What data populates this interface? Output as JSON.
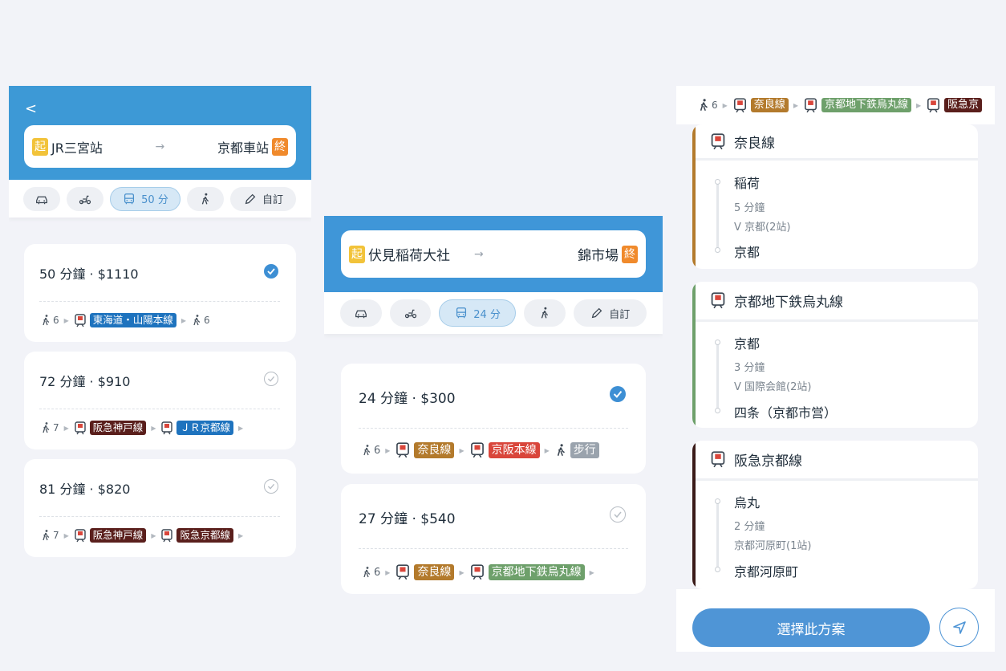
{
  "colors": {
    "header_blue": "#3d99d6",
    "selected_check": "#3d8fd4",
    "start_tag": "#f2c33a",
    "end_tag": "#f08a2c",
    "tokaido": "#1e73be",
    "hankyu": "#5a1f1c",
    "jr_kyoto": "#1e73be",
    "nara": "#b37a2c",
    "keihan": "#d9463b",
    "karasuma": "#6ea06b",
    "walk_tag": "#9aa3ad"
  },
  "screen1": {
    "back": "<",
    "start_tag": "起",
    "end_tag": "終",
    "origin": "JR三宮站",
    "arrow": "→",
    "destination": "京都車站",
    "modes": {
      "transit_label": "50 分",
      "custom_label": "自訂"
    },
    "routes": [
      {
        "summary": "50 分鐘 · $1110",
        "walk1": "6",
        "line1": "東海道・山陽本線",
        "walk2": "6"
      },
      {
        "summary": "72 分鐘 · $910",
        "walk1": "7",
        "line1": "阪急神戸線",
        "line2": "ＪＲ京都線"
      },
      {
        "summary": "81 分鐘 · $820",
        "walk1": "7",
        "line1": "阪急神戸線",
        "line2": "阪急京都線"
      }
    ]
  },
  "screen2": {
    "start_tag": "起",
    "end_tag": "終",
    "origin": "伏見稲荷大社",
    "arrow": "→",
    "destination": "錦市場",
    "modes": {
      "transit_label": "24 分",
      "custom_label": "自訂"
    },
    "routes": [
      {
        "summary": "24 分鐘 · $300",
        "walk1": "6",
        "line1": "奈良線",
        "line2": "京阪本線",
        "walk_tag": "步行"
      },
      {
        "summary": "27 分鐘 · $540",
        "walk1": "6",
        "line1": "奈良線",
        "line2": "京都地下鉄烏丸線"
      }
    ]
  },
  "screen3": {
    "topbar": {
      "walk": "6",
      "line1": "奈良線",
      "line2": "京都地下鉄烏丸線",
      "line3": "阪急京"
    },
    "segments": [
      {
        "line": "奈良線",
        "from": "稲荷",
        "duration": "5 分鐘",
        "via": "V 京都(2站)",
        "to": "京都"
      },
      {
        "line": "京都地下鉄烏丸線",
        "from": "京都",
        "duration": "3 分鐘",
        "via": "V 国際会館(2站)",
        "to": "四条（京都市営）"
      },
      {
        "line": "阪急京都線",
        "from": "烏丸",
        "duration": "2 分鐘",
        "via": "京都河原町(1站)",
        "to": "京都河原町"
      }
    ],
    "choose_button": "選擇此方案"
  }
}
